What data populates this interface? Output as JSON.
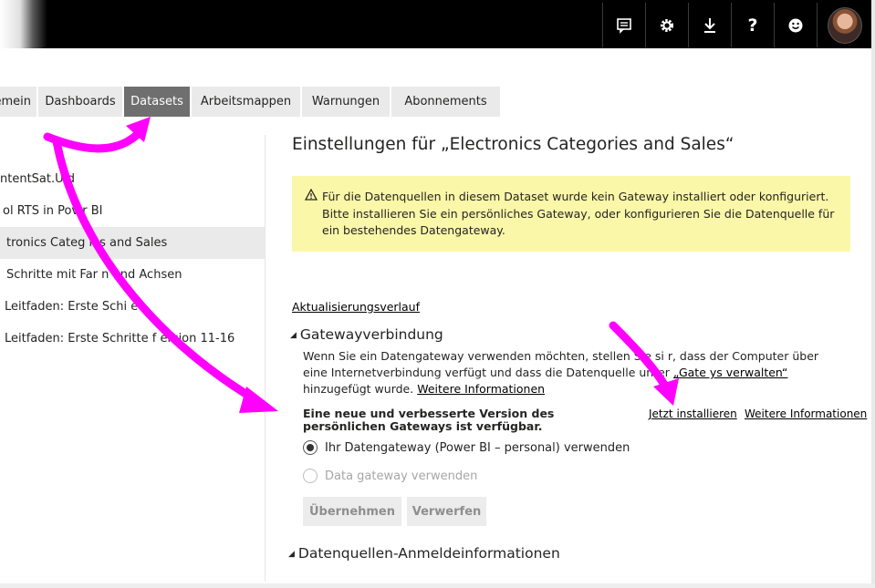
{
  "topbar": {
    "icons": [
      {
        "name": "feedback-icon",
        "glyph": "☷"
      },
      {
        "name": "gear-icon",
        "glyph": "⚙"
      },
      {
        "name": "download-icon",
        "glyph": "⤓"
      },
      {
        "name": "help-icon",
        "glyph": "?"
      },
      {
        "name": "smiley-icon",
        "glyph": "☺"
      }
    ]
  },
  "tabs": [
    {
      "label": "emein",
      "active": false
    },
    {
      "label": "Dashboards",
      "active": false
    },
    {
      "label": "Datasets",
      "active": true
    },
    {
      "label": "Arbeitsmappen",
      "active": false
    },
    {
      "label": "Warnungen",
      "active": false
    },
    {
      "label": "Abonnements",
      "active": false
    }
  ],
  "datasets": [
    {
      "label": "ntentSat.U  d",
      "selected": false
    },
    {
      "label": "ol RTS in Pov  r BI",
      "selected": false
    },
    {
      "label": "tronics Categ  ies and Sales",
      "selected": true
    },
    {
      "label": "Schritte mit Far  n und Achsen",
      "selected": false
    },
    {
      "label": "Leitfaden: Erste Schi  e",
      "selected": false
    },
    {
      "label": "Leitfaden: Erste Schritte f    ersion 11-16",
      "selected": false
    }
  ],
  "main": {
    "title": "Einstellungen für „Electronics Categories and Sales“",
    "warning": {
      "icon": "warning-icon",
      "text": "Für die Datenquellen in diesem Dataset wurde kein Gateway installiert oder konfiguriert. Bitte installieren Sie ein persönliches Gateway, oder konfigurieren Sie die Datenquelle für ein bestehendes Datengateway."
    },
    "history_link": "Aktualisierungsverlauf",
    "gateway": {
      "heading": "Gatewayverbindung",
      "desc_before": "Wenn Sie ein Datengateway verwenden möchten, stellen Sie si     r, dass der Computer über eine Internetverbindung verfügt und dass die Datenquelle unter ",
      "desc_link": "„Gate     ys verwalten“",
      "desc_after": " hinzugefügt wurde. ",
      "more_link": "Weitere Informationen",
      "new_version": "Eine neue und verbesserte Version des persönlichen Gateways ist verfügbar.",
      "install_link": "Jetzt installieren",
      "more_link2": "Weitere Informationen",
      "option_personal": "Ihr Datengateway (Power BI – personal) verwenden",
      "option_data": "Data gateway verwenden",
      "apply_label": "Übernehmen",
      "discard_label": "Verwerfen"
    },
    "credentials_heading": "Datenquellen-Anmeldeinformationen"
  },
  "colors": {
    "annotation_arrow": "#ff00ff",
    "warning_bg": "#fbf7a8",
    "active_tab": "#6f6f6f"
  }
}
